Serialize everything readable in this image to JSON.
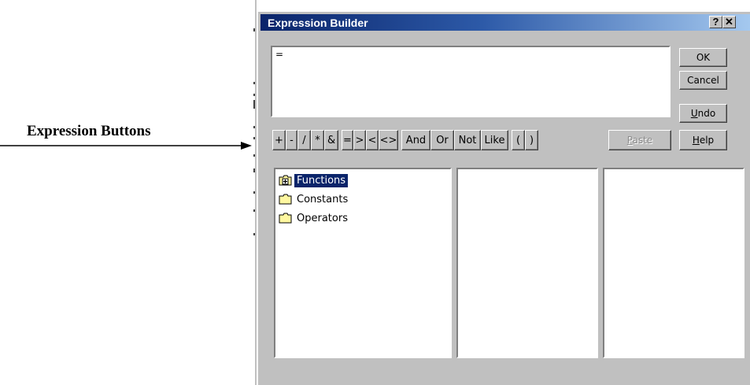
{
  "callout": {
    "label": "Expression Buttons"
  },
  "dialog": {
    "title": "Expression Builder",
    "help_glyph": "?",
    "close_glyph": "✕",
    "expression_text": "=",
    "buttons": {
      "ok": "OK",
      "cancel": "Cancel",
      "undo_prefix": "",
      "undo_accel": "U",
      "undo_rest": "ndo",
      "help_accel": "H",
      "help_rest": "elp",
      "paste_accel": "P",
      "paste_rest": "aste"
    },
    "operators": [
      "+",
      "-",
      "/",
      "*",
      "&",
      "=",
      ">",
      "<",
      "<>",
      "And",
      "Or",
      "Not",
      "Like",
      "(",
      ")"
    ],
    "tree": [
      {
        "label": "Functions",
        "icon": "folder-plus-icon",
        "selected": true
      },
      {
        "label": "Constants",
        "icon": "folder-icon",
        "selected": false
      },
      {
        "label": "Operators",
        "icon": "folder-icon",
        "selected": false
      }
    ]
  },
  "colors": {
    "title_gradient_start": "#0a246a",
    "title_gradient_end": "#a6caf0",
    "face": "#c0c0c0",
    "selection": "#0a246a",
    "folder": "#fff7a0"
  }
}
